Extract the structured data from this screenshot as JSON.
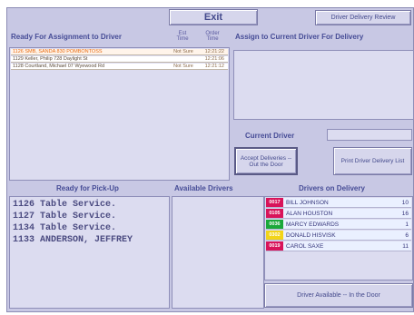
{
  "header": {
    "exit_label": "Exit",
    "driver_review_label": "Driver Delivery Review"
  },
  "ready_assignment": {
    "title": "Ready For Assignment to Driver",
    "col_est": "Est Time",
    "col_order": "Order Time",
    "rows": [
      {
        "name": "1126 SMB, SANDA 830 POMBONTOSS",
        "est": "Not Sure",
        "time": "12:21:22"
      },
      {
        "name": "1129 Keller, Philip 728 Daylight St",
        "est": "",
        "time": "12:21:06"
      },
      {
        "name": "1128 Courtland, Michael 07 Wyewood Rd",
        "est": "Not Sure",
        "time": "12:21:12"
      }
    ]
  },
  "assign_current": {
    "title": "Assign to Current Driver For Delivery"
  },
  "current_driver": {
    "label": "Current Driver",
    "value": ""
  },
  "actions": {
    "accept_label": "Accept Deliveries -- Out the Door",
    "print_label": "Print Driver Delivery List"
  },
  "pickup": {
    "title": "Ready for Pick-Up",
    "items": [
      "1126 Table Service.",
      "1127 Table Service.",
      "1134 Table Service.",
      "1133 ANDERSON, JEFFREY"
    ]
  },
  "available_drivers": {
    "title": "Available Drivers"
  },
  "on_delivery": {
    "title": "Drivers on Delivery",
    "drivers": [
      {
        "code": "0017",
        "name": "BILL JOHNSON",
        "count": "10",
        "color": "#d8145a"
      },
      {
        "code": "0105",
        "name": "ALAN HOUSTON",
        "count": "16",
        "color": "#d8145a"
      },
      {
        "code": "0036",
        "name": "MARCY EDWARDS",
        "count": "1",
        "color": "#1aa83a"
      },
      {
        "code": "0302",
        "name": "DONALD HISVISK",
        "count": "6",
        "color": "#f2d418"
      },
      {
        "code": "0019",
        "name": "CAROL SAXE",
        "count": "11",
        "color": "#d8145a"
      }
    ],
    "footer_label": "Driver Available -- In the Door"
  },
  "colors": {
    "background": "#c8c8e4",
    "accent_text": "#464c96",
    "order_row_text": "#e86a10"
  }
}
